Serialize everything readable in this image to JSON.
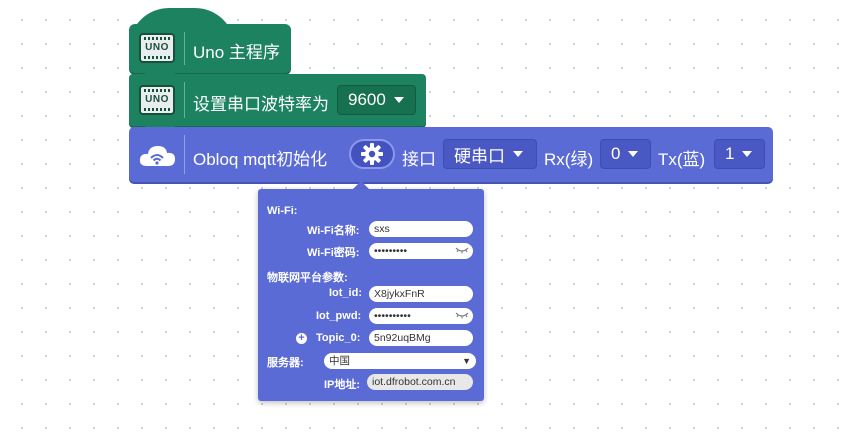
{
  "blocks": {
    "main": {
      "label": "Uno 主程序",
      "icon": "uno-board-icon",
      "icon_text": "UNO"
    },
    "serial": {
      "label": "设置串口波特率为",
      "baud_value": "9600",
      "icon": "uno-board-icon",
      "icon_text": "UNO"
    },
    "obloq": {
      "label": "Obloq mqtt初始化",
      "icon": "wifi-cloud-icon",
      "settings_icon": "gear-icon",
      "port_label": "接口",
      "port_value": "硬串口",
      "rx_label": "Rx(绿)",
      "rx_value": "0",
      "tx_label": "Tx(蓝)",
      "tx_value": "1"
    }
  },
  "popup": {
    "wifi_section": "Wi-Fi:",
    "wifi_name_label": "Wi-Fi名称:",
    "wifi_name_value": "sxs",
    "wifi_pwd_label": "Wi-Fi密码:",
    "wifi_pwd_value": "•••••••••",
    "iot_section": "物联网平台参数:",
    "iot_id_label": "Iot_id:",
    "iot_id_value": "X8jykxFnR",
    "iot_pwd_label": "Iot_pwd:",
    "iot_pwd_value": "••••••••••",
    "topic_label": "Topic_0:",
    "topic_value": "5n92uqBMg",
    "server_label": "服务器:",
    "server_value": "中国",
    "ip_label": "IP地址:",
    "ip_value": "iot.dfrobot.com.cn"
  },
  "colors": {
    "green_block": "#1d8260",
    "blue_block": "#5b6bd6"
  }
}
